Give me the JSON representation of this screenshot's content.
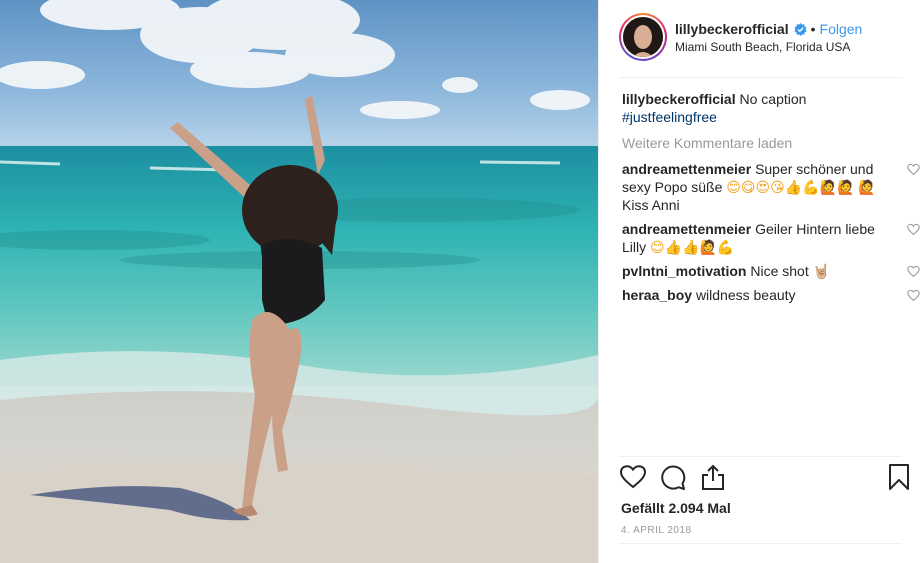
{
  "post": {
    "username": "lillybeckerofficial",
    "separator": "•",
    "follow_label": "Folgen",
    "location": "Miami South Beach, Florida USA",
    "caption_user": "lillybeckerofficial",
    "caption_text": "No caption",
    "caption_hashtag": "#justfeelingfree",
    "load_more_label": "Weitere Kommentare laden",
    "comments": [
      {
        "user": "andreamettenmeier",
        "text": "Super schöner und sexy Popo süße",
        "emojis": "😊😋😍😘👍💪🙋🙋",
        "text2": "🙋Kiss Anni"
      },
      {
        "user": "andreamettenmeier",
        "text": "Geiler Hintern liebe Lilly",
        "emojis": "😊👍👍🙋💪"
      },
      {
        "user": "pvlntni_motivation",
        "text": "Nice shot",
        "emojis": "🤘🏼"
      },
      {
        "user": "heraa_boy",
        "text": "wildness beauty"
      }
    ],
    "likes_text": "Gefällt 2.094 Mal",
    "date_text": "4. April 2018"
  },
  "icons": {
    "like": "heart-outline-icon",
    "comment": "speech-bubble-icon",
    "share": "share-upload-icon",
    "save": "bookmark-icon",
    "verified": "verified-badge-icon",
    "comment_like": "small-heart-icon"
  },
  "colors": {
    "link": "#3897f0",
    "hashtag": "#003569",
    "muted": "#999999",
    "verified": "#3897f0"
  }
}
